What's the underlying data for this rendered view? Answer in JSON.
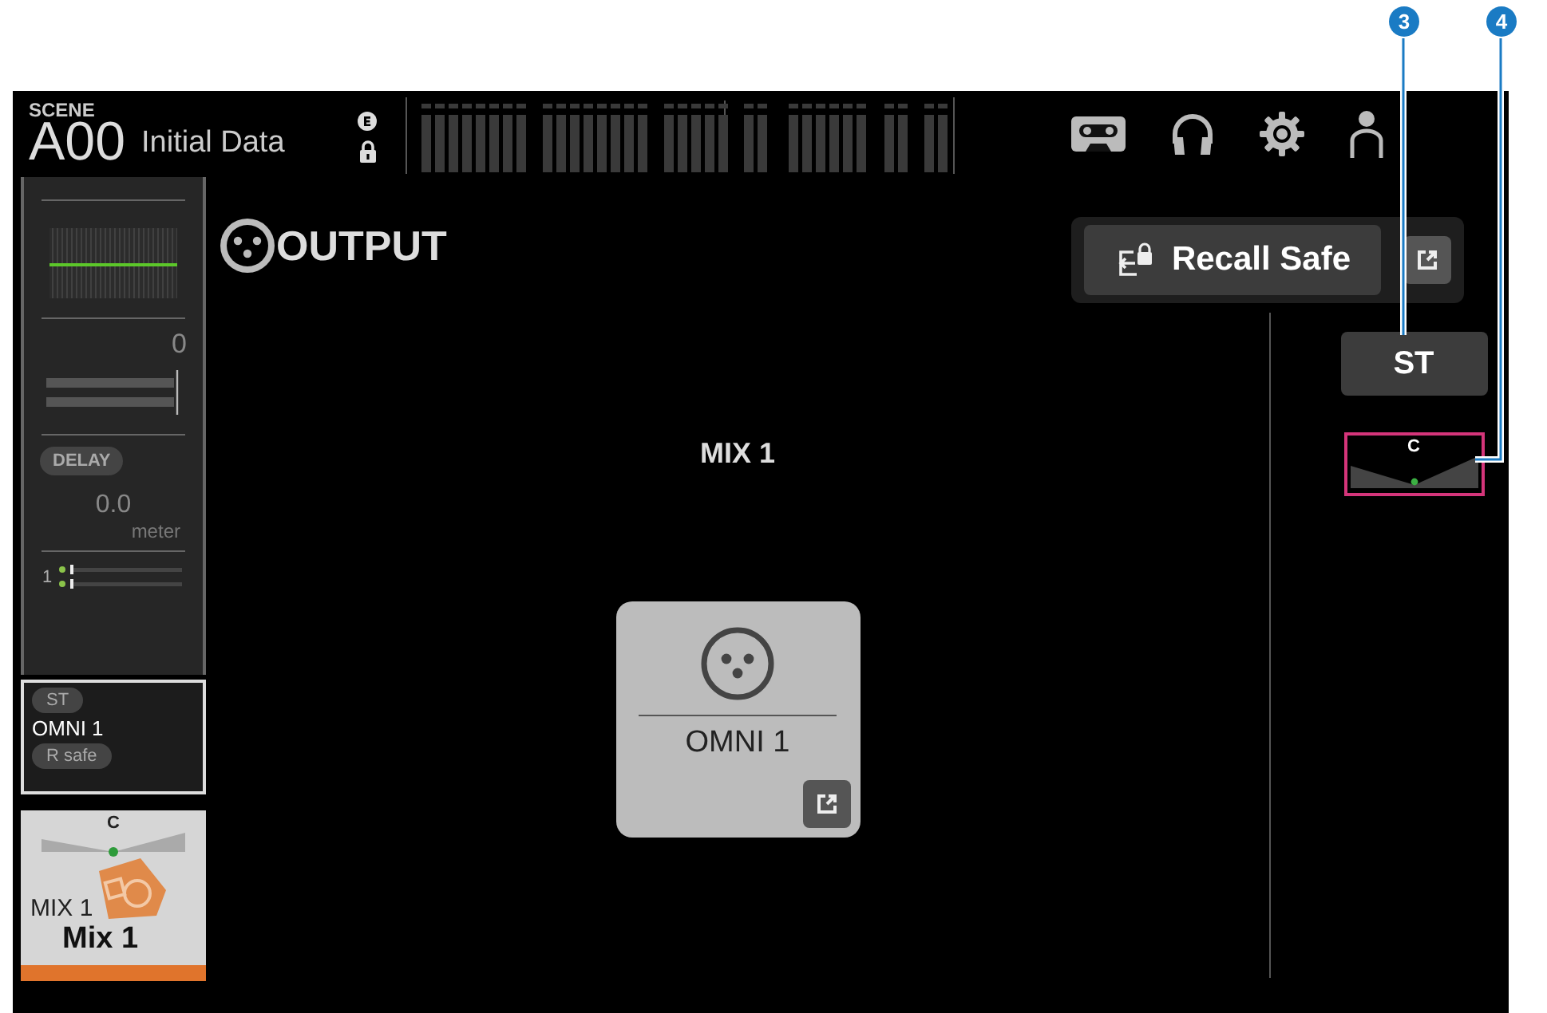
{
  "callouts": [
    {
      "number": "3"
    },
    {
      "number": "4"
    }
  ],
  "scene": {
    "label": "SCENE",
    "number": "A00",
    "title": "Initial Data"
  },
  "channel_strip": {
    "gain": "0",
    "delay_button": "DELAY",
    "delay_value": "0.0",
    "delay_unit": "meter",
    "send_number": "1",
    "input_tag": "ST",
    "input_name": "OMNI 1",
    "safe_tag": "R safe",
    "pan_label": "C",
    "mix_label": "MIX 1",
    "mix_name": "Mix 1"
  },
  "output": {
    "title": "OUTPUT",
    "recall_safe": "Recall Safe",
    "mix_title": "MIX 1",
    "port_name": "OMNI 1",
    "st_button": "ST",
    "pan_label": "C"
  }
}
